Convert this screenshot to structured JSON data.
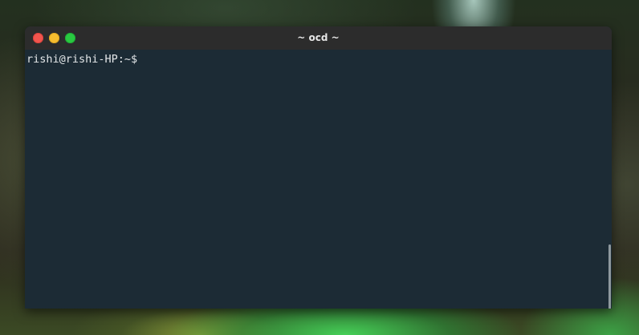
{
  "window": {
    "title": "~ ocd ~"
  },
  "terminal": {
    "prompt": "rishi@rishi-HP:~$"
  },
  "icons": {
    "close": "close-icon",
    "minimize": "minimize-icon",
    "maximize": "maximize-icon"
  },
  "colors": {
    "terminal_background": "#1c2b35",
    "titlebar_background": "#2c2c2c",
    "close_button": "#f2554e",
    "minimize_button": "#f6bd2f",
    "maximize_button": "#29c941",
    "text": "#e3e6e8"
  }
}
